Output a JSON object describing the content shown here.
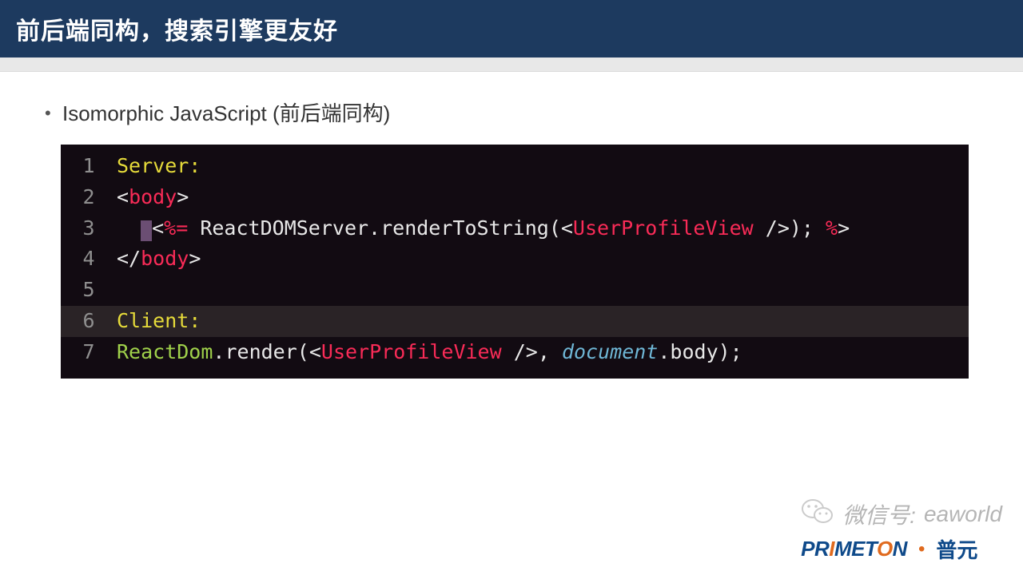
{
  "header": {
    "title": "前后端同构，搜索引擎更友好"
  },
  "bullet": {
    "text": "Isomorphic JavaScript (前后端同构)"
  },
  "code": {
    "lines": [
      {
        "n": "1",
        "tokens": [
          {
            "c": "t-yellow",
            "t": "Server:"
          }
        ]
      },
      {
        "n": "2",
        "tokens": [
          {
            "c": "",
            "t": "<"
          },
          {
            "c": "t-red",
            "t": "body"
          },
          {
            "c": "",
            "t": ">"
          }
        ]
      },
      {
        "n": "3",
        "tokens": [
          {
            "c": "",
            "t": "  "
          },
          {
            "cursor": true
          },
          {
            "c": "",
            "t": "<"
          },
          {
            "c": "t-red",
            "t": "%="
          },
          {
            "c": "",
            "t": " ReactDOMServer.renderToString(<"
          },
          {
            "c": "t-red",
            "t": "UserProfileView"
          },
          {
            "c": "t-grey",
            "t": " "
          },
          {
            "c": "",
            "t": "/>); "
          },
          {
            "c": "t-red",
            "t": "%"
          },
          {
            "c": "",
            "t": ">"
          }
        ]
      },
      {
        "n": "4",
        "tokens": [
          {
            "c": "",
            "t": "</"
          },
          {
            "c": "t-red",
            "t": "body"
          },
          {
            "c": "",
            "t": ">"
          }
        ]
      },
      {
        "n": "5",
        "tokens": [
          {
            "c": "",
            "t": ""
          }
        ]
      },
      {
        "n": "6",
        "hl": true,
        "tokens": [
          {
            "c": "t-yellow",
            "t": "Client:"
          }
        ]
      },
      {
        "n": "7",
        "tokens": [
          {
            "c": "t-green",
            "t": "ReactDom"
          },
          {
            "c": "",
            "t": ".render(<"
          },
          {
            "c": "t-red",
            "t": "UserProfileView"
          },
          {
            "c": "t-grey",
            "t": " "
          },
          {
            "c": "",
            "t": "/>, "
          },
          {
            "c": "t-blue",
            "t": "document"
          },
          {
            "c": "",
            "t": ".body);"
          }
        ]
      }
    ]
  },
  "watermark": {
    "wechat_label": "微信号:",
    "wechat_id": "eaworld",
    "brand_en_1": "PR",
    "brand_en_2": "I",
    "brand_en_3": "MET",
    "brand_en_4": "O",
    "brand_en_5": "N",
    "dot": "•",
    "brand_cn": "普元"
  }
}
